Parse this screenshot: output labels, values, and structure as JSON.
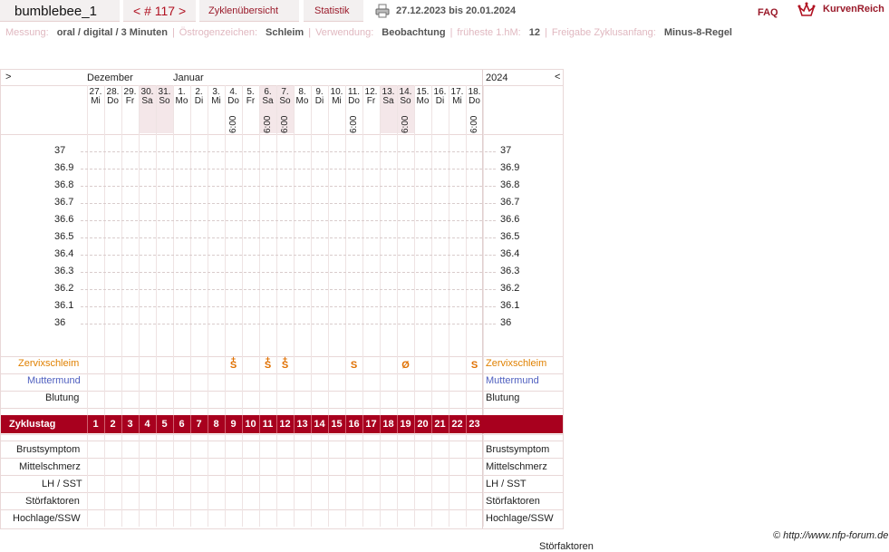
{
  "header": {
    "cycle_name": "bumblebee_1",
    "cycle_nav": "< # 117 >",
    "tab_overview": "Zyklenübersicht",
    "tab_stats": "Statistik",
    "date_range": "27.12.2023 bis 20.01.2024",
    "faq": "FAQ",
    "logo_text": "KurvenReich",
    "icons": {
      "print": "printer-icon",
      "logo": "kurvenreich-logo-icon"
    }
  },
  "settings": {
    "measurement_label": "Messung:",
    "measurement_value": "oral / digital / 3 Minuten",
    "estrogen_label": "Östrogenzeichen:",
    "estrogen_value": "Schleim",
    "usage_label": "Verwendung:",
    "usage_value": "Beobachtung",
    "earliest_label": "früheste 1.hM:",
    "earliest_value": "12",
    "release_label": "Freigabe Zyklusanfang:",
    "release_value": "Minus-8-Regel",
    "separator": "|"
  },
  "chart": {
    "nav_left": ">",
    "nav_right": "<",
    "months": [
      "Dezember",
      "Januar"
    ],
    "year": "2024",
    "days": [
      {
        "num": "27.",
        "name": "Mi",
        "weekend": false,
        "time": ""
      },
      {
        "num": "28.",
        "name": "Do",
        "weekend": false,
        "time": ""
      },
      {
        "num": "29.",
        "name": "Fr",
        "weekend": false,
        "time": ""
      },
      {
        "num": "30.",
        "name": "Sa",
        "weekend": true,
        "time": ""
      },
      {
        "num": "31.",
        "name": "So",
        "weekend": true,
        "time": ""
      },
      {
        "num": "1.",
        "name": "Mo",
        "weekend": false,
        "time": ""
      },
      {
        "num": "2.",
        "name": "Di",
        "weekend": false,
        "time": ""
      },
      {
        "num": "3.",
        "name": "Mi",
        "weekend": false,
        "time": ""
      },
      {
        "num": "4.",
        "name": "Do",
        "weekend": false,
        "time": "6:00"
      },
      {
        "num": "5.",
        "name": "Fr",
        "weekend": false,
        "time": ""
      },
      {
        "num": "6.",
        "name": "Sa",
        "weekend": true,
        "time": "6:00"
      },
      {
        "num": "7.",
        "name": "So",
        "weekend": true,
        "time": "6:00"
      },
      {
        "num": "8.",
        "name": "Mo",
        "weekend": false,
        "time": ""
      },
      {
        "num": "9.",
        "name": "Di",
        "weekend": false,
        "time": ""
      },
      {
        "num": "10.",
        "name": "Mi",
        "weekend": false,
        "time": ""
      },
      {
        "num": "11.",
        "name": "Do",
        "weekend": false,
        "time": "6:00"
      },
      {
        "num": "12.",
        "name": "Fr",
        "weekend": false,
        "time": ""
      },
      {
        "num": "13.",
        "name": "Sa",
        "weekend": true,
        "time": ""
      },
      {
        "num": "14.",
        "name": "So",
        "weekend": true,
        "time": "6:00"
      },
      {
        "num": "15.",
        "name": "Mo",
        "weekend": false,
        "time": ""
      },
      {
        "num": "16.",
        "name": "Di",
        "weekend": false,
        "time": ""
      },
      {
        "num": "17.",
        "name": "Mi",
        "weekend": false,
        "time": ""
      },
      {
        "num": "18.",
        "name": "Do",
        "weekend": false,
        "time": "6:00"
      }
    ],
    "temperatures": [
      "37",
      "36.9",
      "36.8",
      "36.7",
      "36.6",
      "36.5",
      "36.4",
      "36.3",
      "36.2",
      "36.1",
      "36"
    ],
    "rows_top": [
      {
        "label": "Zervixschleim",
        "color": "#e08000"
      },
      {
        "label": "Muttermund",
        "color": "#5060c0"
      },
      {
        "label": "Blutung",
        "color": "#222222"
      }
    ],
    "cervix_marks": [
      {
        "day": 9,
        "symbol": "S",
        "plus": "+"
      },
      {
        "day": 11,
        "symbol": "S",
        "plus": "+"
      },
      {
        "day": 12,
        "symbol": "S",
        "plus": "+"
      },
      {
        "day": 16,
        "symbol": "S",
        "plus": ""
      },
      {
        "day": 19,
        "symbol": "Ø",
        "plus": ""
      },
      {
        "day": 23,
        "symbol": "S",
        "plus": ""
      }
    ],
    "zyklustag_label": "Zyklustag",
    "cycle_days": [
      "1",
      "2",
      "3",
      "4",
      "5",
      "6",
      "7",
      "8",
      "9",
      "10",
      "11",
      "12",
      "13",
      "14",
      "15",
      "16",
      "17",
      "18",
      "19",
      "20",
      "21",
      "22",
      "23"
    ],
    "rows_bottom": [
      "Brustsymptom",
      "Mittelschmerz",
      "LH / SST",
      "Störfaktoren",
      "Hochlage/SSW"
    ]
  },
  "footer": {
    "copyright": "© http://www.nfp-forum.de",
    "stoerfaktoren": "Störfaktoren"
  },
  "colors": {
    "accent": "#a8001e",
    "header_bg": "#f3f0f0",
    "weekend": "#f4e7e9",
    "cervix": "#e08000"
  }
}
